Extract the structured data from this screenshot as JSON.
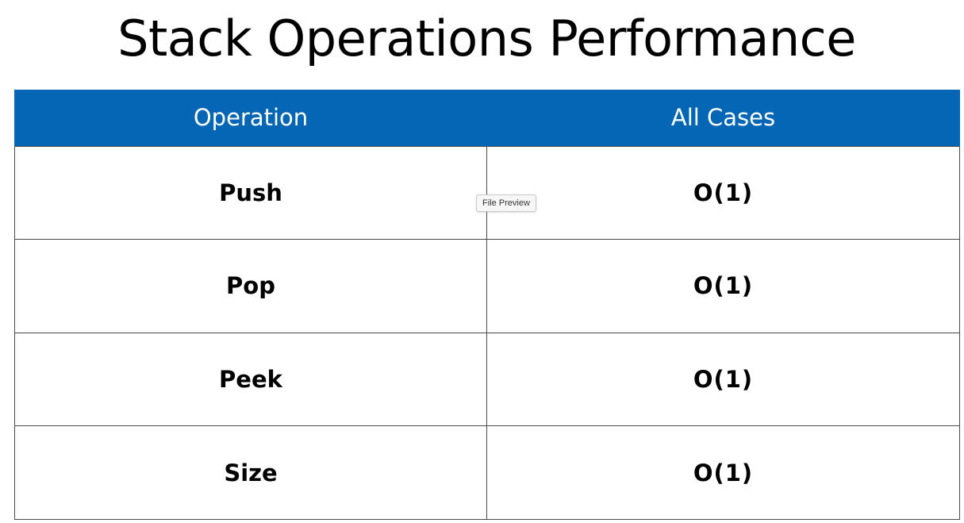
{
  "title": "Stack Operations Performance",
  "table": {
    "headers": {
      "operation": "Operation",
      "complexity": "All Cases"
    },
    "rows": [
      {
        "operation": "Push",
        "complexity": "O(1)"
      },
      {
        "operation": "Pop",
        "complexity": "O(1)"
      },
      {
        "operation": "Peek",
        "complexity": "O(1)"
      },
      {
        "operation": "Size",
        "complexity": "O(1)"
      }
    ]
  },
  "tooltip": "File Preview",
  "colors": {
    "header_background": "#0466b4",
    "header_text": "#ffffff",
    "grid_lines": "#4a4a4a"
  }
}
